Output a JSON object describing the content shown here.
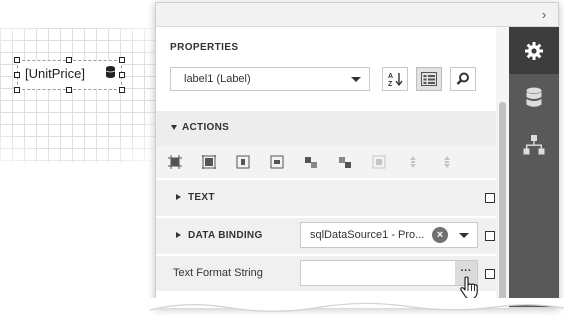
{
  "design_surface": {
    "label_text": "[UnitPrice]"
  },
  "panel": {
    "title": "PROPERTIES",
    "component_selector": {
      "value": "label1 (Label)"
    },
    "toolbar": {
      "sort_alphabetical": "sort-alphabetical-icon",
      "categorized": "categorized-view-icon",
      "search": "search-icon"
    },
    "sections": {
      "actions": {
        "label": "ACTIONS"
      },
      "text": {
        "label": "TEXT"
      },
      "data_binding": {
        "label": "DATA BINDING",
        "value": "sqlDataSource1 - Pro..."
      },
      "text_format_string": {
        "label": "Text Format String",
        "value": "",
        "ellipsis": "···"
      }
    },
    "sidebar_tabs": [
      "properties-gear-icon",
      "data-source-icon",
      "report-explorer-icon"
    ]
  },
  "colors": {
    "sidebar": "#595959",
    "sidebar_active": "#3d3d3d",
    "section_header": "#ededed"
  }
}
